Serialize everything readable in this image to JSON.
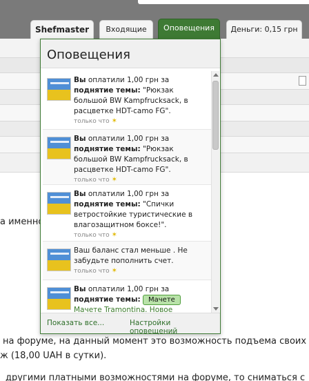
{
  "header": {
    "tabs": {
      "user": "Shefmaster",
      "inbox": "Входящие",
      "alerts": "Оповещения",
      "balance": "Деньги: 0,15 грн"
    }
  },
  "page": {
    "line1": "а именно:",
    "line2": "на форуме, на данный момент это возможность подъема своих",
    "line3": "ж (18,00 UAH в сутки).",
    "line4": "другими платными возможностями на форуме, то сниматься с"
  },
  "popup": {
    "title": "Оповещения",
    "items": [
      {
        "actor": "Вы",
        "text1": "оплатили 1,00 грн за",
        "bold": "поднятие темы:",
        "quote": "\"Рюкзак большой BW Kampfrucksack, в расцветке HDT-camo FG\".",
        "time": "только что"
      },
      {
        "actor": "Вы",
        "text1": "оплатили 1,00 грн за",
        "bold": "поднятие темы:",
        "quote": "\"Рюкзак большой BW Kampfrucksack, в расцветке HDT-camo FG\".",
        "time": "только что"
      },
      {
        "actor": "Вы",
        "text1": "оплатили 1,00 грн за",
        "bold": "поднятие темы:",
        "quote": "\"Спички ветростойкие туристические в влагозащитном боксе!\".",
        "time": "только что"
      },
      {
        "text1": "Ваш баланс стал меньше . Не забудьте пополнить счет.",
        "time": "только что"
      },
      {
        "actor": "Вы",
        "text1": "оплатили 1,00 грн за",
        "bold": "поднятие темы:",
        "button": "Мачете",
        "quote": "Мачете Tramontina. Новое"
      }
    ],
    "footer": {
      "show_all": "Показать все...",
      "settings": "Настройки оповещений"
    }
  }
}
